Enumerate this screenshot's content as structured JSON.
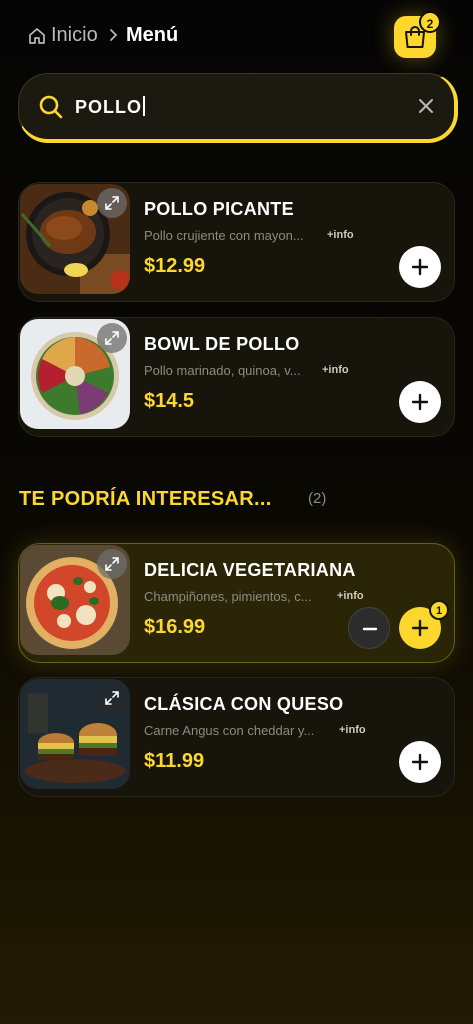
{
  "breadcrumb": {
    "home_label": "Inicio",
    "current_label": "Menú"
  },
  "cart": {
    "count": "2",
    "icon": "shopping-bag-icon"
  },
  "search": {
    "value": "POLLO",
    "placeholder": ""
  },
  "results": [
    {
      "name": "POLLO PICANTE",
      "description": "Pollo crujiente con mayon...",
      "info_label": "+info",
      "price": "$12.99"
    },
    {
      "name": "BOWL DE POLLO",
      "description": "Pollo marinado, quinoa, v...",
      "info_label": "+info",
      "price": "$14.5"
    }
  ],
  "suggestions": {
    "title": "TE PODRÍA INTERESAR...",
    "count": "(2)",
    "items": [
      {
        "name": "DELICIA VEGETARIANA",
        "description": "Champiñones, pimientos, c...",
        "info_label": "+info",
        "price": "$16.99",
        "quantity": "1"
      },
      {
        "name": "CLÁSICA CON QUESO",
        "description": "Carne Angus con cheddar y...",
        "info_label": "+info",
        "price": "$11.99"
      }
    ]
  },
  "colors": {
    "accent": "#fcd72e",
    "background": "#050505",
    "card": "#16140b",
    "muted_text": "#8d8a7f"
  }
}
